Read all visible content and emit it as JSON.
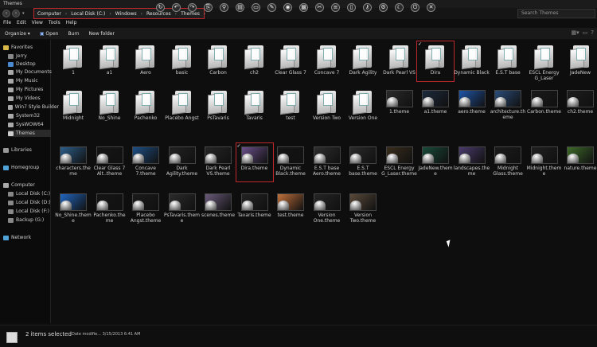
{
  "window": {
    "title": "Themes"
  },
  "address": {
    "crumbs": [
      "Computer",
      "Local Disk (C:)",
      "Windows",
      "Resources",
      "Themes"
    ],
    "search_placeholder": "Search Themes"
  },
  "menu": [
    "File",
    "Edit",
    "View",
    "Tools",
    "Help"
  ],
  "toolbar": {
    "organize": "Organize",
    "open": "Open",
    "burn": "Burn",
    "new_folder": "New folder"
  },
  "sidebar": {
    "favorites": "Favorites",
    "items": [
      "Jerry",
      "Desktop",
      "My Documents",
      "My Music",
      "My Pictures",
      "My Videos",
      "Win7 Style Builder",
      "System32",
      "SysWOW64",
      "Themes"
    ],
    "libraries": "Libraries",
    "homegroup": "Homegroup",
    "computer": "Computer",
    "drives": [
      "Local Disk (C:)",
      "Local Disk (D:)",
      "Local Disk (F:)",
      "Backup (G:)"
    ],
    "network": "Network"
  },
  "rows": [
    [
      {
        "label": "1",
        "kind": "folder"
      },
      {
        "label": "a1",
        "kind": "folder"
      },
      {
        "label": "Aero",
        "kind": "folder"
      },
      {
        "label": "basic",
        "kind": "folder"
      },
      {
        "label": "Carbon",
        "kind": "folder"
      },
      {
        "label": "ch2",
        "kind": "folder"
      },
      {
        "label": "Clear Glass 7",
        "kind": "folder"
      },
      {
        "label": "Concave 7",
        "kind": "folder"
      },
      {
        "label": "Dark Agility",
        "kind": "folder"
      },
      {
        "label": "Dark Pearl VS",
        "kind": "folder"
      },
      {
        "label": "Dira",
        "kind": "folder",
        "selected": true
      },
      {
        "label": "Dynamic Black",
        "kind": "folder"
      },
      {
        "label": "E.S.T base",
        "kind": "folder"
      },
      {
        "label": "ESCL Energy G_Laser",
        "kind": "folder"
      },
      {
        "label": "JadeNew",
        "kind": "folder"
      }
    ],
    [
      {
        "label": "Midnight",
        "kind": "folder"
      },
      {
        "label": "No_Shine",
        "kind": "folder"
      },
      {
        "label": "Pachenko",
        "kind": "folder"
      },
      {
        "label": "Placebo Angst",
        "kind": "folder"
      },
      {
        "label": "PsTavaris",
        "kind": "folder"
      },
      {
        "label": "Tavaris",
        "kind": "folder"
      },
      {
        "label": "test",
        "kind": "folder"
      },
      {
        "label": "Version Two",
        "kind": "folder"
      },
      {
        "label": "Version One",
        "kind": "folder"
      },
      {
        "label": "1.theme",
        "kind": "theme",
        "color": "#2a2a2a"
      },
      {
        "label": "a1.theme",
        "kind": "theme",
        "color": "#1c2a3c"
      },
      {
        "label": "aero.theme",
        "kind": "theme",
        "color": "#1f55a8"
      },
      {
        "label": "architecture.theme",
        "kind": "theme",
        "color": "#2b4d7a"
      },
      {
        "label": "Carbon.theme",
        "kind": "theme",
        "color": "#1a1a1a"
      },
      {
        "label": "ch2.theme",
        "kind": "theme",
        "color": "#1c1c1c"
      }
    ],
    [
      {
        "label": "characters.theme",
        "kind": "theme",
        "color": "#2d5e8a"
      },
      {
        "label": "Clear Glass 7 Alt..theme",
        "kind": "theme",
        "color": "#151515"
      },
      {
        "label": "Concave 7.theme",
        "kind": "theme",
        "color": "#1e4f86"
      },
      {
        "label": "Dark Agility.theme",
        "kind": "theme",
        "color": "#222222"
      },
      {
        "label": "Dark Pearl VS.theme",
        "kind": "theme",
        "color": "#262626"
      },
      {
        "label": "Dira.theme",
        "kind": "theme",
        "color": "#6a4f8a",
        "selected": true
      },
      {
        "label": "Dynamic Black.theme",
        "kind": "theme",
        "color": "#141414"
      },
      {
        "label": "E.S.T base Aero.theme",
        "kind": "theme",
        "color": "#2e2e2e"
      },
      {
        "label": "E.S.T base.theme",
        "kind": "theme",
        "color": "#2a2a2a"
      },
      {
        "label": "ESCL Energy G_Laser.theme",
        "kind": "theme",
        "color": "#3a2d1c"
      },
      {
        "label": "JadeNew.theme",
        "kind": "theme",
        "color": "#184a3a"
      },
      {
        "label": "landscapes.theme",
        "kind": "theme",
        "color": "#4a3a6c"
      },
      {
        "label": "Midnight Glass.theme",
        "kind": "theme",
        "color": "#1b1b1b"
      },
      {
        "label": "Midnight.theme",
        "kind": "theme",
        "color": "#202020"
      },
      {
        "label": "nature.theme",
        "kind": "theme",
        "color": "#3e6a2a"
      }
    ],
    [
      {
        "label": "No_Shine.theme",
        "kind": "theme",
        "color": "#2066c0"
      },
      {
        "label": "Pachenko.theme",
        "kind": "theme",
        "color": "#151515"
      },
      {
        "label": "Placebo Angst.theme",
        "kind": "theme",
        "color": "#1a1a1a"
      },
      {
        "label": "PsTavaris.theme",
        "kind": "theme",
        "color": "#2b2b2b"
      },
      {
        "label": "scenes.theme",
        "kind": "theme",
        "color": "#6a5a7a"
      },
      {
        "label": "Tavaris.theme",
        "kind": "theme",
        "color": "#222222"
      },
      {
        "label": "test.theme",
        "kind": "theme",
        "color": "#c0703a"
      },
      {
        "label": "Version One.theme",
        "kind": "theme",
        "color": "#252525"
      },
      {
        "label": "Version Two.theme",
        "kind": "theme",
        "color": "#5a4a3a"
      }
    ]
  ],
  "status": {
    "selected": "2 items selected",
    "meta_label": "Date modifie...",
    "meta_value": "3/15/2013 6:41 AM"
  },
  "colors": {
    "highlight": "#c0272d",
    "background": "#0e0e0e"
  }
}
